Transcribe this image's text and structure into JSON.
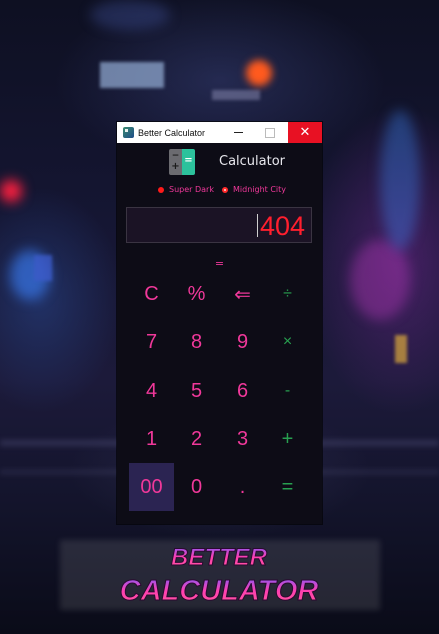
{
  "window": {
    "title": "Better Calculator",
    "controls": {
      "minimize": "–",
      "maximize": "□",
      "close": "✕"
    }
  },
  "header": {
    "logo_glyphs": {
      "minus": "−",
      "plus": "+",
      "equals": "="
    },
    "title": "Calculator"
  },
  "themes": [
    {
      "label": "Super Dark",
      "selected": false
    },
    {
      "label": "Midnight City",
      "selected": true
    }
  ],
  "display": {
    "value": "404",
    "equals_label": "="
  },
  "keys": [
    {
      "label": "C",
      "name": "clear-button"
    },
    {
      "label": "%",
      "name": "percent-button"
    },
    {
      "label": "⇐",
      "name": "backspace-button"
    },
    {
      "label": "÷",
      "name": "divide-button"
    },
    {
      "label": "7",
      "name": "seven-button"
    },
    {
      "label": "8",
      "name": "eight-button"
    },
    {
      "label": "9",
      "name": "nine-button"
    },
    {
      "label": "×",
      "name": "multiply-button"
    },
    {
      "label": "4",
      "name": "four-button"
    },
    {
      "label": "5",
      "name": "five-button"
    },
    {
      "label": "6",
      "name": "six-button"
    },
    {
      "label": "-",
      "name": "subtract-button"
    },
    {
      "label": "1",
      "name": "one-button"
    },
    {
      "label": "2",
      "name": "two-button"
    },
    {
      "label": "3",
      "name": "three-button"
    },
    {
      "label": "+",
      "name": "add-button"
    },
    {
      "label": "00",
      "name": "double-zero-button"
    },
    {
      "label": "0",
      "name": "zero-button"
    },
    {
      "label": ".",
      "name": "decimal-button"
    },
    {
      "label": "=",
      "name": "equals-button"
    }
  ],
  "banner": {
    "line1": "BETTER",
    "line2": "CALCULATOR"
  },
  "colors": {
    "accent_pink": "#f0389a",
    "operator_green": "#28a050",
    "display_red": "#ff1f2e",
    "close_red": "#e81123",
    "logo_teal": "#2cc29c",
    "active_key": "#2b2452"
  }
}
